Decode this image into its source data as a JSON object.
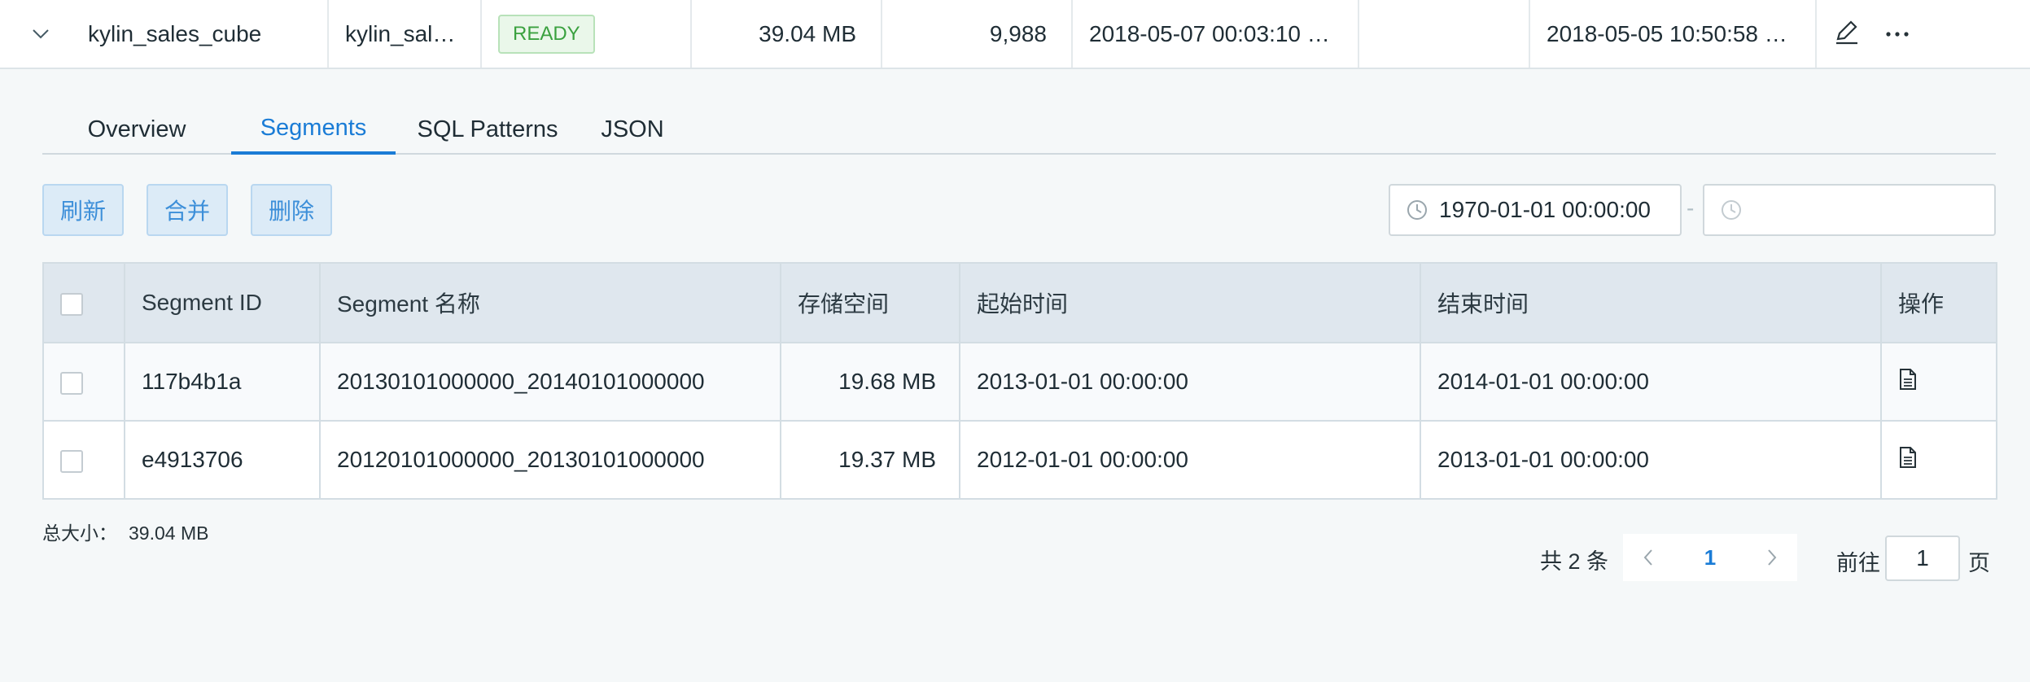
{
  "cube": {
    "name": "kylin_sales_cube",
    "model": "kylin_sal…",
    "status": "READY",
    "size": "39.04 MB",
    "rows": "9,988",
    "last_build": "2018-05-07 00:03:10 …",
    "empty": "",
    "last_modified": "2018-05-05 10:50:58 …",
    "edit_icon": "pencil-icon",
    "more_icon": "ellipsis-icon"
  },
  "tabs": [
    {
      "label": "Overview",
      "active": false
    },
    {
      "label": "Segments",
      "active": true
    },
    {
      "label": "SQL Patterns",
      "active": false
    },
    {
      "label": "JSON",
      "active": false
    }
  ],
  "toolbar": {
    "refresh": "刷新",
    "merge": "合并",
    "delete": "删除"
  },
  "date_filter": {
    "start": "1970-01-01 00:00:00",
    "separator": "-",
    "end": ""
  },
  "table": {
    "headers": [
      "Segment ID",
      "Segment 名称",
      "存储空间",
      "起始时间",
      "结束时间",
      "操作"
    ],
    "rows": [
      {
        "id": "117b4b1a",
        "name": "20130101000000_20140101000000",
        "size": "19.68 MB",
        "start": "2013-01-01 00:00:00",
        "end": "2014-01-01 00:00:00"
      },
      {
        "id": "e4913706",
        "name": "20120101000000_20130101000000",
        "size": "19.37 MB",
        "start": "2012-01-01 00:00:00",
        "end": "2013-01-01 00:00:00"
      }
    ]
  },
  "footer": {
    "total_label": "总大小：",
    "total_value": "39.04 MB",
    "pager_total": "共 2 条",
    "current_page": "1",
    "goto_label": "前往",
    "goto_value": "1",
    "goto_suffix": "页"
  },
  "colors": {
    "accent": "#1a7cd6",
    "ready_green": "#3aa13f",
    "toolbar_button_bg": "#dcebf7"
  }
}
